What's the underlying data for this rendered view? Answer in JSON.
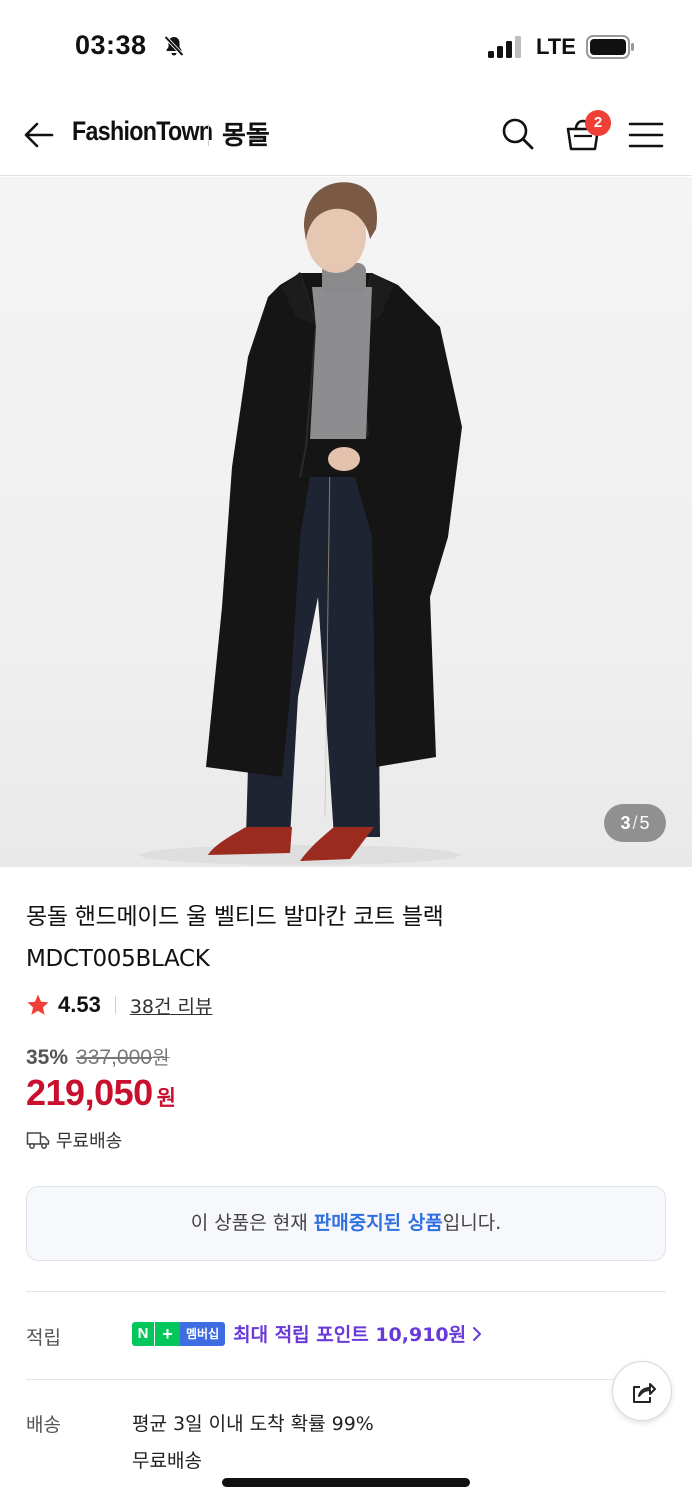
{
  "status_bar": {
    "time": "03:38",
    "network": "LTE",
    "icons": [
      "bell-slash-icon",
      "signal-icon",
      "battery-icon"
    ]
  },
  "header": {
    "brand_logo": "FashionTown",
    "brand_name": "몽돌",
    "cart_count": "2",
    "icons": [
      "back-arrow-icon",
      "search-icon",
      "shopping-bag-icon",
      "menu-icon"
    ]
  },
  "gallery": {
    "current": "3",
    "separator": "/",
    "total": "5"
  },
  "product": {
    "title_line1": "몽돌 핸드메이드 울 벨티드 발마칸 코트 블랙",
    "title_line2": "MDCT005BLACK",
    "rating": "4.53",
    "review_link": "38건 리뷰",
    "discount_rate": "35%",
    "original_price": "337,000",
    "original_unit": "원",
    "sale_price": "219,050",
    "sale_unit": "원",
    "shipping_label": "무료배송"
  },
  "notice": {
    "prefix": "이 상품은 현재 ",
    "emphasis": "판매중지된 상품",
    "suffix": "입니다."
  },
  "points": {
    "label": "적립",
    "npay_n": "N",
    "npay_plus": "+",
    "npay_membership": "멤버십",
    "text": "최대 적립 포인트 10,910원"
  },
  "delivery": {
    "label": "배송",
    "line1": "평균 3일 이내 도착 확률 99%",
    "line2": "무료배송"
  },
  "colors": {
    "price_red": "#c8102e",
    "badge_red": "#ef3f36",
    "notice_blue": "#2f6fe0",
    "points_purple": "#6a3ad9",
    "naver_green": "#03c75a",
    "membership_blue": "#3d6de0"
  }
}
